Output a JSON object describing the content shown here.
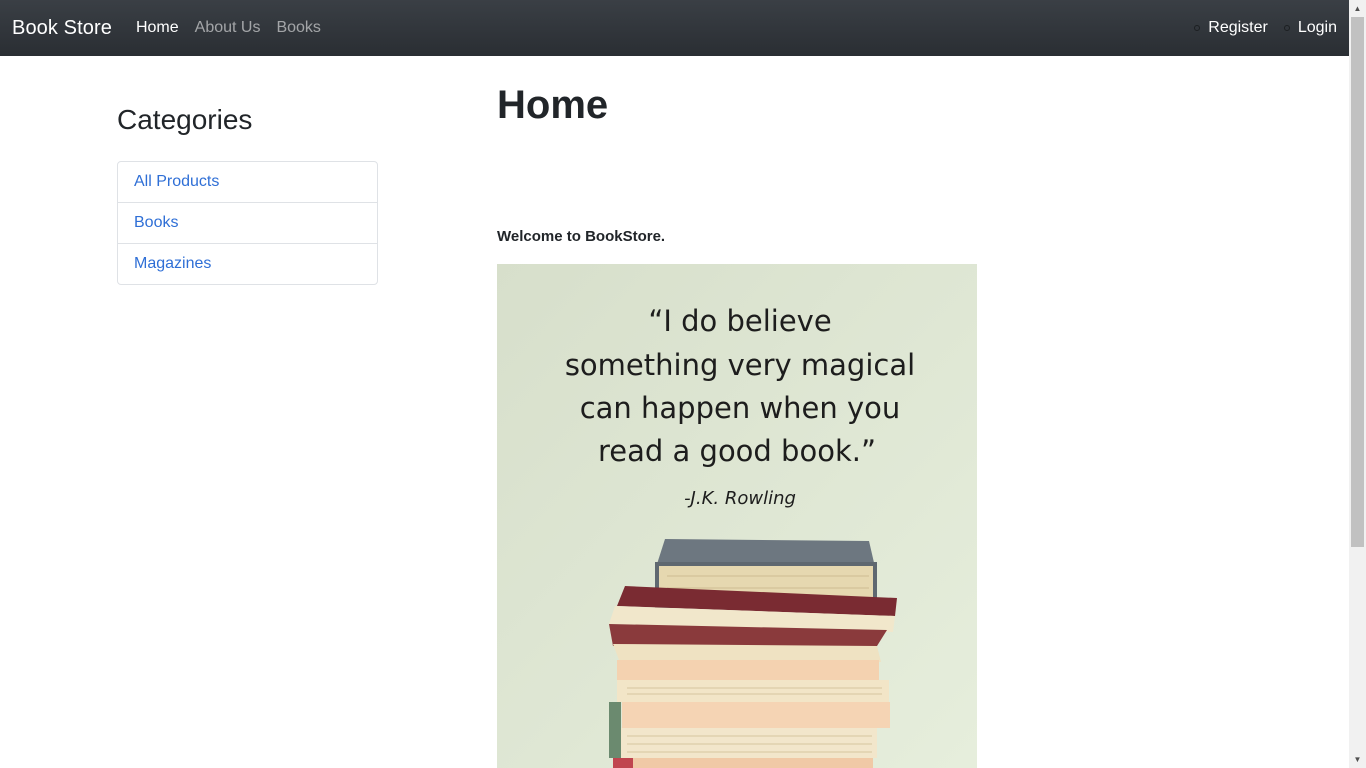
{
  "navbar": {
    "brand": "Book Store",
    "links": [
      "Home",
      "About Us",
      "Books"
    ],
    "right_links": [
      "Register",
      "Login"
    ]
  },
  "sidebar": {
    "title": "Categories",
    "items": [
      "All Products",
      "Books",
      "Magazines"
    ]
  },
  "main": {
    "title": "Home",
    "welcome": "Welcome to BookStore.",
    "poster": {
      "quote_lines": [
        "“I do believe",
        "something very magical",
        "can happen when you",
        "read a good book.”"
      ],
      "author": "-J.K. Rowling"
    }
  },
  "colors": {
    "navbar_bg": "#343a40",
    "link": "#2f6fd6",
    "poster_bg": "#dfe6d3"
  },
  "icons": [
    "bullet-icon",
    "scroll-up-arrow-icon",
    "scroll-down-arrow-icon"
  ]
}
